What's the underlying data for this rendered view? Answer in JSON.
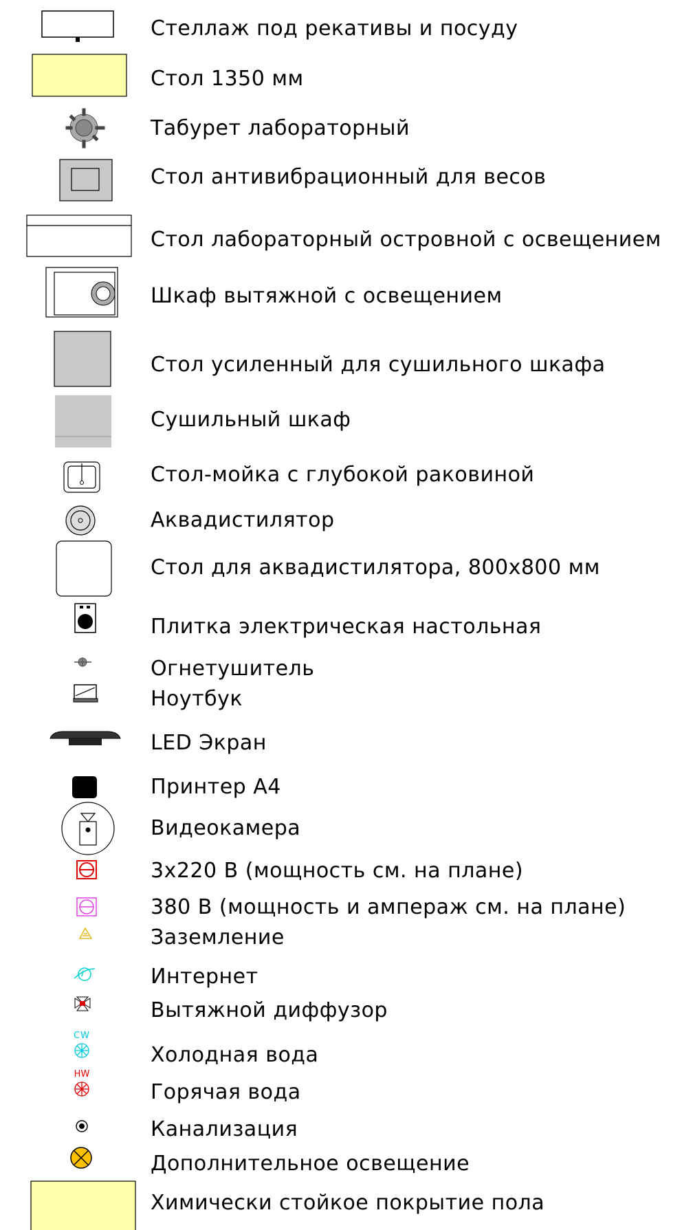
{
  "legend": {
    "items": [
      {
        "id": "rack",
        "icon": "rack-icon",
        "label": "Стеллаж под рекативы и посуду"
      },
      {
        "id": "table1350",
        "icon": "table-yellow-icon",
        "label": "Стол 1350 мм"
      },
      {
        "id": "stool",
        "icon": "stool-icon",
        "label": "Табурет лабораторный"
      },
      {
        "id": "antivib",
        "icon": "antivibration-table-icon",
        "label": "Стол антивибрационный для весов"
      },
      {
        "id": "island",
        "icon": "island-table-icon",
        "label": "Стол лабораторный островной с освещением"
      },
      {
        "id": "fumehood",
        "icon": "fume-hood-icon",
        "label": "Шкаф вытяжной с освещением"
      },
      {
        "id": "reinforced",
        "icon": "reinforced-table-icon",
        "label": "Стол усиленный для сушильного шкафа"
      },
      {
        "id": "dryer",
        "icon": "drying-cabinet-icon",
        "label": "Сушильный шкаф"
      },
      {
        "id": "sink",
        "icon": "sink-icon",
        "label": "Стол-мойка с глубокой раковиной"
      },
      {
        "id": "distiller",
        "icon": "distiller-icon",
        "label": "Аквадистилятор"
      },
      {
        "id": "distillertable",
        "icon": "distiller-table-icon",
        "label": "Стол для аквадистилятора, 800x800 мм"
      },
      {
        "id": "hotplate",
        "icon": "hotplate-icon",
        "label": "Плитка электрическая настольная"
      },
      {
        "id": "extinguisher",
        "icon": "extinguisher-icon",
        "label": "Огнетушитель"
      },
      {
        "id": "laptop",
        "icon": "laptop-icon",
        "label": "Ноутбук"
      },
      {
        "id": "led",
        "icon": "led-screen-icon",
        "label": "LED Экран"
      },
      {
        "id": "printer",
        "icon": "printer-icon",
        "label": "Принтер А4"
      },
      {
        "id": "camera",
        "icon": "video-camera-icon",
        "label": "Видеокамера"
      },
      {
        "id": "socket220",
        "icon": "socket-220-icon",
        "label": "3x220 В (мощность см. на плане)"
      },
      {
        "id": "socket380",
        "icon": "socket-380-icon",
        "label": "380 В (мощность и ампераж см. на плане)"
      },
      {
        "id": "ground",
        "icon": "ground-icon",
        "label": "Заземление"
      },
      {
        "id": "internet",
        "icon": "internet-icon",
        "label": "Интернет"
      },
      {
        "id": "diffuser",
        "icon": "exhaust-diffuser-icon",
        "label": "Вытяжной диффузор"
      },
      {
        "id": "coldwater",
        "icon": "cold-water-icon",
        "label": "Холодная вода",
        "tag": "CW"
      },
      {
        "id": "hotwater",
        "icon": "hot-water-icon",
        "label": "Горячая вода",
        "tag": "HW"
      },
      {
        "id": "sewer",
        "icon": "sewer-icon",
        "label": "Канализация"
      },
      {
        "id": "extralight",
        "icon": "extra-lighting-icon",
        "label": "Дополнительное освещение"
      },
      {
        "id": "floor",
        "icon": "floor-coating-icon",
        "label": "Химически стойкое покрытие пола"
      }
    ]
  },
  "colors": {
    "yellow_fill": "#ffffaa",
    "gray_fill": "#c8c8c8",
    "socket_red": "#e00000",
    "socket_magenta": "#e040e0",
    "ground_yellow": "#e0b000",
    "internet_cyan": "#00d0d0",
    "lamp_orange": "#ffc000"
  }
}
